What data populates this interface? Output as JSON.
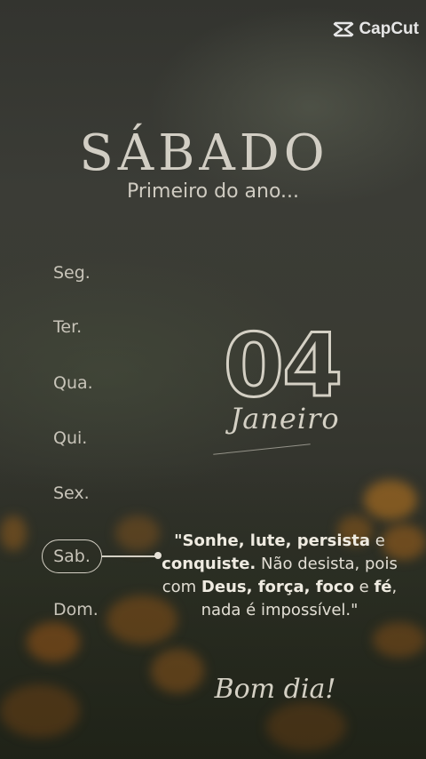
{
  "brand": {
    "logo_text": "CapCut"
  },
  "header": {
    "day": "SÁBADO",
    "subtitle": "Primeiro do ano..."
  },
  "weekdays": [
    {
      "label": "Seg."
    },
    {
      "label": "Ter."
    },
    {
      "label": "Qua."
    },
    {
      "label": "Qui."
    },
    {
      "label": "Sex."
    },
    {
      "label": "Sab.",
      "active": true
    },
    {
      "label": "Dom."
    }
  ],
  "date": {
    "day_number": "04",
    "month": "Janeiro"
  },
  "quote": {
    "p1": "\"Sonhe, lute, persista",
    "p2": " e ",
    "p3": "conquiste.",
    "p4": " Não desista, pois com ",
    "p5": "Deus, força, foco",
    "p6": " e ",
    "p7": "fé",
    "p8": ", nada é impossível.\""
  },
  "greeting": "Bom dia!",
  "colors": {
    "text": "#d4d0c4",
    "background": "#33342f",
    "accent_flower": "#b8731e"
  }
}
